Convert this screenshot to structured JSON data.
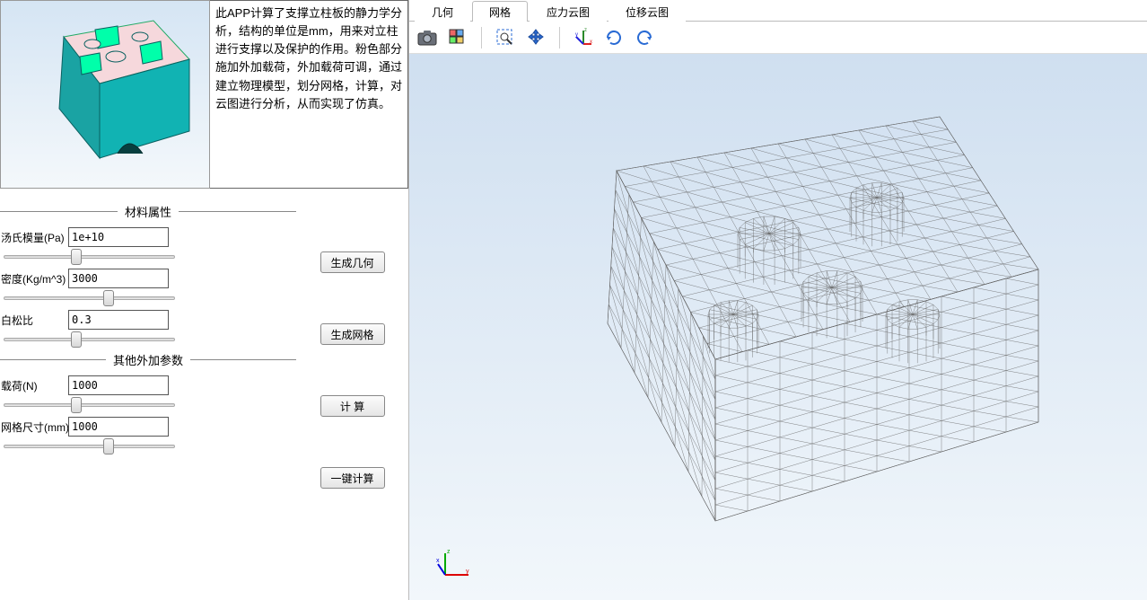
{
  "description": "此APP计算了支撑立柱板的静力学分析，结构的单位是mm，用来对立柱进行支撑以及保护的作用。粉色部分施加外加载荷，外加载荷可调，通过建立物理模型，划分网格，计算，对云图进行分析，从而实现了仿真。",
  "sections": {
    "material": "材料属性",
    "other": "其他外加参数"
  },
  "fields": {
    "youngs": {
      "label": "汤氏模量(Pa)",
      "value": "1e+10"
    },
    "density": {
      "label": "密度(Kg/m^3)",
      "value": "3000"
    },
    "poisson": {
      "label": "白松比",
      "value": "0.3"
    },
    "load": {
      "label": "载荷(N)",
      "value": "1000"
    },
    "mesh": {
      "label": "网格尺寸(mm)",
      "value": "1000"
    }
  },
  "buttons": {
    "geom": "生成几何",
    "mesh": "生成网格",
    "calc": "计 算",
    "oneclick": "一键计算"
  },
  "tabs": {
    "geom": "几何",
    "mesh": "网格",
    "stress": "应力云图",
    "disp": "位移云图"
  },
  "toolbar_icons": {
    "camera": "camera-icon",
    "select": "select-icon",
    "zoombox": "zoom-box-icon",
    "pan": "pan-icon",
    "axes": "axes-icon",
    "rotcw": "rotate-cw-icon",
    "rotccw": "rotate-ccw-icon"
  }
}
